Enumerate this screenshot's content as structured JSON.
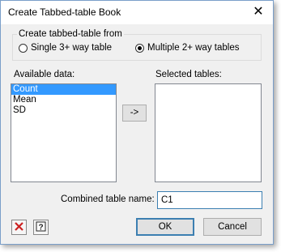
{
  "window": {
    "title": "Create Tabbed-table Book",
    "close_glyph": "✕"
  },
  "create_group": {
    "legend": "Create tabbed-table from",
    "options": [
      {
        "label": "Single 3+ way table",
        "checked": false
      },
      {
        "label": "Multiple 2+ way tables",
        "checked": true
      }
    ]
  },
  "available": {
    "label": "Available data:",
    "items": [
      "Count",
      "Mean",
      "SD"
    ],
    "selected": 0
  },
  "move_button": {
    "label": "->"
  },
  "selected_tables": {
    "label": "Selected tables:",
    "items": []
  },
  "combined": {
    "label": "Combined table name:",
    "value": "C1"
  },
  "buttons": {
    "ok": "OK",
    "cancel": "Cancel"
  },
  "icons": {
    "clear": "clear-icon",
    "help": "help-icon"
  },
  "colors": {
    "selection": "#3399ff",
    "clear_icon": "#cc2222"
  }
}
